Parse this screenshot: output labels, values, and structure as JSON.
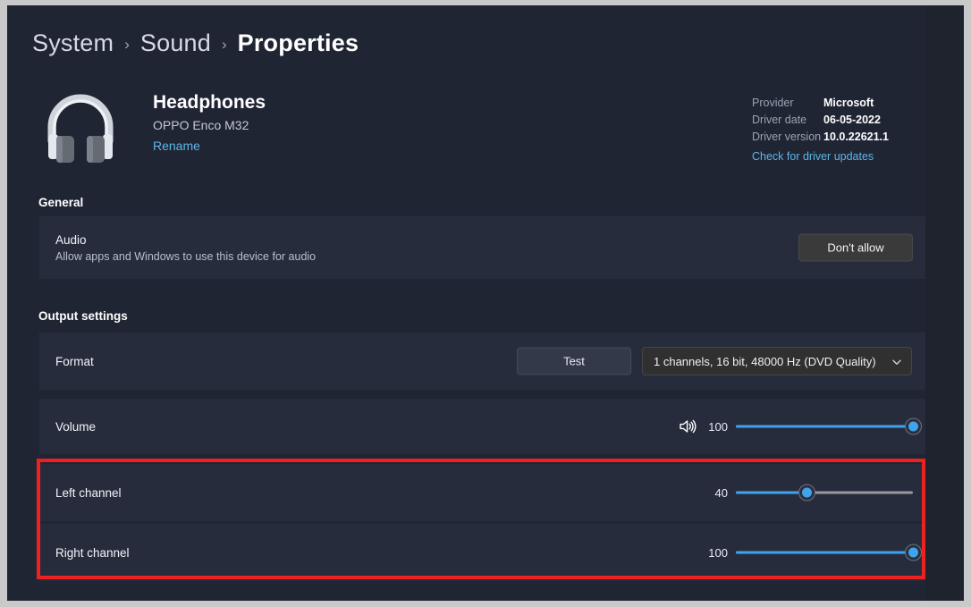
{
  "breadcrumb": {
    "items": [
      {
        "label": "System",
        "current": false
      },
      {
        "label": "Sound",
        "current": false
      },
      {
        "label": "Properties",
        "current": true
      }
    ],
    "separator": "›"
  },
  "device": {
    "icon": "headphones-icon",
    "name": "Headphones",
    "model": "OPPO Enco M32",
    "rename_label": "Rename"
  },
  "driver": {
    "provider_label": "Provider",
    "provider_value": "Microsoft",
    "date_label": "Driver date",
    "date_value": "06-05-2022",
    "version_label": "Driver version",
    "version_value": "10.0.22621.1",
    "updates_link": "Check for driver updates"
  },
  "general": {
    "heading": "General",
    "audio": {
      "title": "Audio",
      "subtitle": "Allow apps and Windows to use this device for audio",
      "button_label": "Don't allow"
    }
  },
  "output": {
    "heading": "Output settings",
    "format": {
      "title": "Format",
      "test_label": "Test",
      "selected_value": "1 channels, 16 bit, 48000 Hz (DVD Quality)",
      "chevron": "chevron-down-icon"
    },
    "volume": {
      "title": "Volume",
      "icon": "speaker-volume-icon",
      "value": 100,
      "min": 0,
      "max": 100
    },
    "left_channel": {
      "title": "Left channel",
      "value": 40,
      "min": 0,
      "max": 100
    },
    "right_channel": {
      "title": "Right channel",
      "value": 100,
      "min": 0,
      "max": 100
    }
  },
  "annotation": {
    "highlight_color": "#ef2020"
  },
  "colors": {
    "page_background": "#202534",
    "card_background": "#272c3d",
    "accent_link": "#5cb6e8",
    "slider_accent": "#3fa3ee",
    "slider_track": "#9a9a9a"
  }
}
